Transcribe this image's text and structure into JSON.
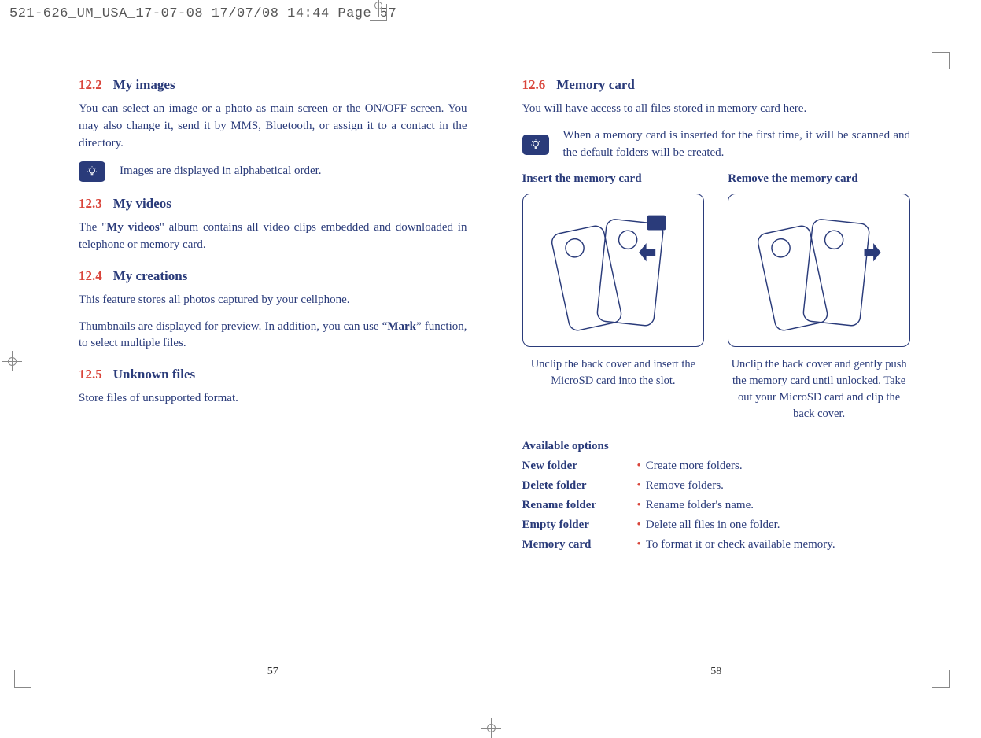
{
  "header": "521-626_UM_USA_17-07-08  17/07/08  14:44  Page 57",
  "left": {
    "s1": {
      "num": "12.2",
      "title": "My images",
      "p1": "You can select an image or a photo as main screen or the ON/OFF screen. You may also change it, send it by MMS, Bluetooth, or assign it to a contact in the directory.",
      "tip": "Images are displayed in alphabetical order."
    },
    "s2": {
      "num": "12.3",
      "title": "My videos",
      "p1a": "The \"",
      "p1b": "My videos",
      "p1c": "\" album contains all video clips embedded and downloaded in telephone or memory card."
    },
    "s3": {
      "num": "12.4",
      "title": "My creations",
      "p1": "This feature stores all photos captured by your cellphone.",
      "p2a": "Thumbnails are displayed for preview. In addition, you can use “",
      "p2b": "Mark",
      "p2c": "” function, to select multiple files."
    },
    "s4": {
      "num": "12.5",
      "title": "Unknown files",
      "p1": "Store files of unsupported format."
    },
    "pagenum": "57"
  },
  "right": {
    "s1": {
      "num": "12.6",
      "title": "Memory card",
      "p1": "You will have access to all files stored in memory card here.",
      "tip": "When a memory card is inserted for the first time, it will be scanned and the default folders will be created."
    },
    "insert": {
      "title": "Insert the memory card",
      "caption": "Unclip the back cover and insert the MicroSD card into the slot."
    },
    "remove": {
      "title": "Remove the memory card",
      "caption": "Unclip the back cover and gently push the memory card until unlocked. Take out your MicroSD card and clip the back cover."
    },
    "opts_title": "Available options",
    "opts": [
      {
        "label": "New folder",
        "desc": "Create more folders."
      },
      {
        "label": "Delete folder",
        "desc": "Remove folders."
      },
      {
        "label": "Rename folder",
        "desc": "Rename folder's name."
      },
      {
        "label": "Empty folder",
        "desc": "Delete all files in one folder."
      },
      {
        "label": "Memory card",
        "desc": "To format it or check available memory."
      }
    ],
    "pagenum": "58"
  }
}
